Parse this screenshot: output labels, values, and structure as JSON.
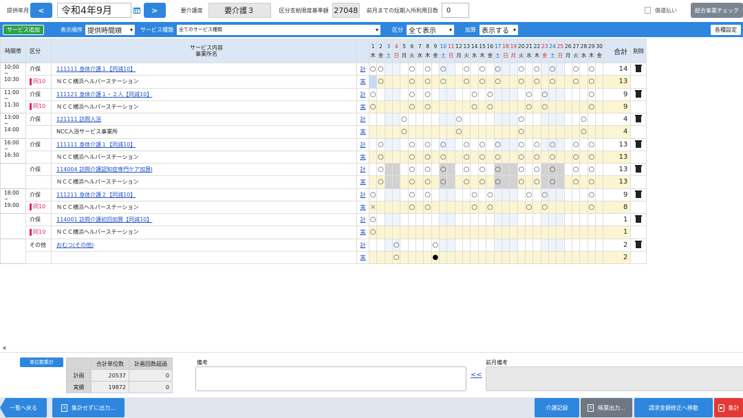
{
  "header": {
    "period_label": "提供年月",
    "prev_icon": "<",
    "next_icon": ">",
    "date_value": "令和4年9月",
    "care_level_label": "要介護度",
    "care_level_value": "要介護３",
    "limit_label": "区分支給限度基準額",
    "limit_value": "27048",
    "short_stay_label": "前月までの短期入所利用日数",
    "short_stay_value": "0",
    "refund_label": "償還払い",
    "check_button": "総合事業チェック"
  },
  "filter": {
    "add_service": "サービス追加",
    "order_label": "表示順序",
    "order_value": "提供時間順",
    "type_label": "サービス種類",
    "type_value": "全てのサービス種類",
    "division_label": "区分",
    "division_value": "全て表示",
    "addition_label": "加算",
    "addition_value": "表示する",
    "settings_button": "各種設定"
  },
  "table": {
    "col_time": "時間帯",
    "col_division": "区分",
    "col_service": "サービス内容",
    "col_office": "事業所名",
    "col_total": "合計",
    "col_delete": "削除",
    "plan_mark": "計",
    "actual_mark": "実",
    "days": [
      {
        "n": "1",
        "w": "木",
        "t": ""
      },
      {
        "n": "2",
        "w": "金",
        "t": ""
      },
      {
        "n": "3",
        "w": "土",
        "t": "sat"
      },
      {
        "n": "4",
        "w": "日",
        "t": "sun"
      },
      {
        "n": "5",
        "w": "月",
        "t": ""
      },
      {
        "n": "6",
        "w": "火",
        "t": ""
      },
      {
        "n": "7",
        "w": "水",
        "t": ""
      },
      {
        "n": "8",
        "w": "木",
        "t": ""
      },
      {
        "n": "9",
        "w": "金",
        "t": ""
      },
      {
        "n": "10",
        "w": "土",
        "t": "sat"
      },
      {
        "n": "11",
        "w": "日",
        "t": "sun"
      },
      {
        "n": "12",
        "w": "月",
        "t": ""
      },
      {
        "n": "13",
        "w": "火",
        "t": ""
      },
      {
        "n": "14",
        "w": "水",
        "t": ""
      },
      {
        "n": "15",
        "w": "木",
        "t": ""
      },
      {
        "n": "16",
        "w": "金",
        "t": ""
      },
      {
        "n": "17",
        "w": "土",
        "t": "sat"
      },
      {
        "n": "18",
        "w": "日",
        "t": "sun"
      },
      {
        "n": "19",
        "w": "月",
        "t": "sun"
      },
      {
        "n": "20",
        "w": "火",
        "t": ""
      },
      {
        "n": "21",
        "w": "水",
        "t": ""
      },
      {
        "n": "22",
        "w": "木",
        "t": ""
      },
      {
        "n": "23",
        "w": "金",
        "t": "sun"
      },
      {
        "n": "24",
        "w": "土",
        "t": "sat"
      },
      {
        "n": "25",
        "w": "日",
        "t": "sun"
      },
      {
        "n": "26",
        "w": "月",
        "t": ""
      },
      {
        "n": "27",
        "w": "火",
        "t": ""
      },
      {
        "n": "28",
        "w": "水",
        "t": ""
      },
      {
        "n": "29",
        "w": "木",
        "t": ""
      },
      {
        "n": "30",
        "w": "金",
        "t": ""
      }
    ],
    "rows": [
      {
        "time": "10:00\n~\n10:30",
        "division": "介保",
        "tag": "同10",
        "service": "111111 身体介護１【同減10】",
        "office": "ＮＣＣ横浜ヘルパーステーション",
        "plan": "oo...o.o.o..o.o.o..o.o.o..o.o.o",
        "actual": "bo...o.o.o..o.o.o..o.o.o..o.o.o",
        "ptot": "14",
        "atot": "13",
        "gray": ""
      },
      {
        "time": "11:00\n~\n11:30",
        "division": "介保",
        "tag": "同10",
        "service": "111121 身体介護１・２人【同減10】",
        "office": "ＮＣＣ横浜ヘルパーステーション",
        "plan": "o....o.o.....o.o....o.o.....o.o",
        "actual": "o....o.o.....o.o....o.o.....o.o",
        "ptot": "9",
        "atot": "9",
        "gray": ""
      },
      {
        "time": "13:00\n~\n14:00",
        "division": "介保",
        "tag": "",
        "service": "121111 訪問入浴",
        "office": "NCC入浴サービス事業所",
        "plan": "....o......o.......o.......o...",
        "actual": "....o......o.......o.......o...",
        "ptot": "4",
        "atot": "4",
        "gray": ""
      },
      {
        "time": "16:00\n~\n16:30",
        "division": "介保",
        "tag": "",
        "service": "111111 身体介護１【同減10】",
        "office": "ＮＣＣ横浜ヘルパーステーション",
        "plan": ".o...o.o.o..o.o.o..o.o.o..o.o.o",
        "actual": ".o...o.o.o..o.o.o..o.o.o..o.o.o",
        "ptot": "13",
        "atot": "13",
        "gray": ""
      },
      {
        "time": "",
        "division": "介保",
        "tag": "",
        "service": "114004 訪問介護認知症専門ケア加算Ⅰ",
        "office": "ＮＣＣ横浜ヘルパーステーション",
        "plan": ".o...o.o.o..o.o.o..o.o.o..o.o.o",
        "actual": ".o...o.o.o..o.o.o..o.o.o..o.o.o",
        "ptot": "13",
        "atot": "13",
        "gray": "y"
      },
      {
        "time": "18:00\n~\n19:00",
        "division": "介保",
        "tag": "同10",
        "service": "111211 身体介護２【同減10】",
        "office": "ＮＣＣ横浜ヘルパーステーション",
        "plan": "o....o.o.....o.o....o.o.....o.o",
        "actual": "x....o.o.....o.o....o.o.....o.o",
        "ptot": "9",
        "atot": "8",
        "gray": ""
      },
      {
        "time": "",
        "division": "介保",
        "tag": "同10",
        "service": "114001 訪問介護初回加算【同減10】",
        "office": "ＮＣＣ横浜ヘルパーステーション",
        "plan": "o..............................",
        "actual": "o..............................",
        "ptot": "1",
        "atot": "1",
        "gray": ""
      },
      {
        "time": "",
        "division": "その他",
        "tag": "",
        "service": "おむつ(その他)",
        "office": "",
        "plan": "...o....o......................",
        "actual": "...o....f......................",
        "ptot": "2",
        "atot": "2",
        "gray": ""
      }
    ]
  },
  "summary": {
    "unit_button": "単位数集計",
    "col_total": "合計単位数",
    "col_excess": "計画回数超過",
    "row_plan": "計画",
    "row_actual": "実績",
    "plan_total": "20537",
    "plan_excess": "0",
    "actual_total": "19872",
    "actual_excess": "0",
    "memo_label": "備考",
    "copy_icon": "<<",
    "prev_memo_label": "前月備考"
  },
  "footer": {
    "back": "一覧へ戻る",
    "export_nosum": "集計せずに出力...",
    "care_record": "介護記録",
    "report_output": "帳票出力...",
    "billing": "請求金額修正へ移動",
    "tally": "集計"
  }
}
